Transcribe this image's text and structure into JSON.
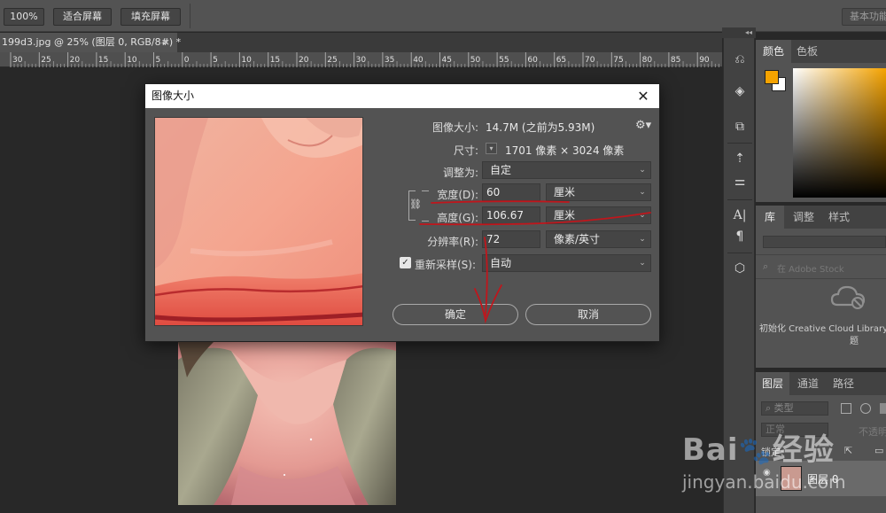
{
  "options_bar": {
    "zoom_100": "100%",
    "fit_screen": "适合屏幕",
    "fill_screen": "填充屏幕",
    "workspace": "基本功能"
  },
  "document": {
    "tab_title": "199d3.jpg @ 25% (图层 0, RGB/8#) *",
    "close_symbol": "×"
  },
  "ruler": {
    "ticks": [
      "30",
      "25",
      "20",
      "15",
      "10",
      "5",
      "0",
      "5",
      "10",
      "15",
      "20",
      "25",
      "30",
      "35",
      "40",
      "45",
      "50",
      "55",
      "60",
      "65",
      "70",
      "75",
      "80",
      "85",
      "90"
    ]
  },
  "dialog": {
    "title": "图像大小",
    "close_symbol": "✕",
    "image_size_label": "图像大小:",
    "image_size_value": "14.7M (之前为5.93M)",
    "dimensions_label": "尺寸:",
    "dimensions_value": "1701 像素 × 3024 像素",
    "fit_to_label": "调整为:",
    "fit_to_value": "自定",
    "width_label": "宽度(D):",
    "width_value": "60",
    "width_unit": "厘米",
    "height_label": "高度(G):",
    "height_value": "106.67",
    "height_unit": "厘米",
    "resolution_label": "分辨率(R):",
    "resolution_value": "72",
    "resolution_unit": "像素/英寸",
    "resample_label": "重新采样(S):",
    "resample_value": "自动",
    "ok_label": "确定",
    "cancel_label": "取消"
  },
  "right_panels": {
    "color_tab": "颜色",
    "swatches_tab": "色板",
    "library_tab": "库",
    "adjust_tab": "调整",
    "style_tab": "样式",
    "library_search_placeholder": "在 Adobe Stock",
    "library_init_text": "初始化 Creative Cloud Library",
    "library_init_tail": "题",
    "layers_tab": "图层",
    "channels_tab": "通道",
    "paths_tab": "路径",
    "layer_filter": "类型",
    "blend_mode": "正常",
    "opacity_label": "不透明",
    "lock_label": "锁定:",
    "layer_name": "图层 0"
  },
  "colors": {
    "foreground": "#f5a300",
    "background": "#ffffff",
    "annotation_red": "#c0161c"
  }
}
